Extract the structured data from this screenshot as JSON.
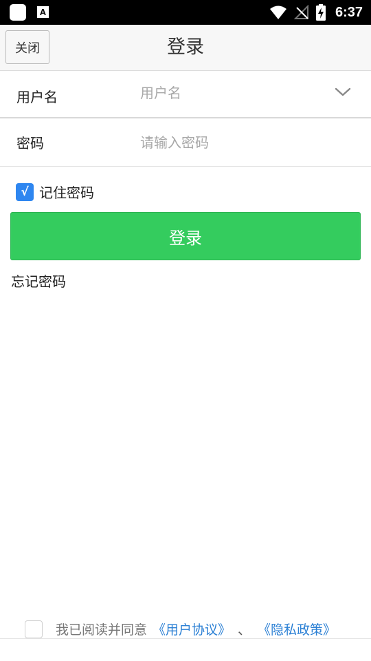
{
  "status_bar": {
    "time": "6:37",
    "icons": [
      "app-icon",
      "text-a-icon",
      "wifi-icon",
      "no-signal-icon",
      "battery-charging-icon"
    ]
  },
  "header": {
    "close_label": "关闭",
    "title": "登录"
  },
  "form": {
    "username": {
      "label": "用户名",
      "placeholder": "用户名",
      "value": ""
    },
    "password": {
      "label": "密码",
      "placeholder": "请输入密码",
      "value": ""
    },
    "remember": {
      "label": "记住密码",
      "checked": true,
      "check_glyph": "√"
    },
    "login_label": "登录",
    "forgot_label": "忘记密码"
  },
  "agreement": {
    "checked": false,
    "text": "我已阅读并同意",
    "user_agreement": "《用户协议》",
    "separator": "、",
    "privacy_policy": "《隐私政策》"
  },
  "colors": {
    "accent_green": "#34cc5e",
    "checkbox_blue": "#2e86f0",
    "link_blue": "#2a7fd4"
  }
}
